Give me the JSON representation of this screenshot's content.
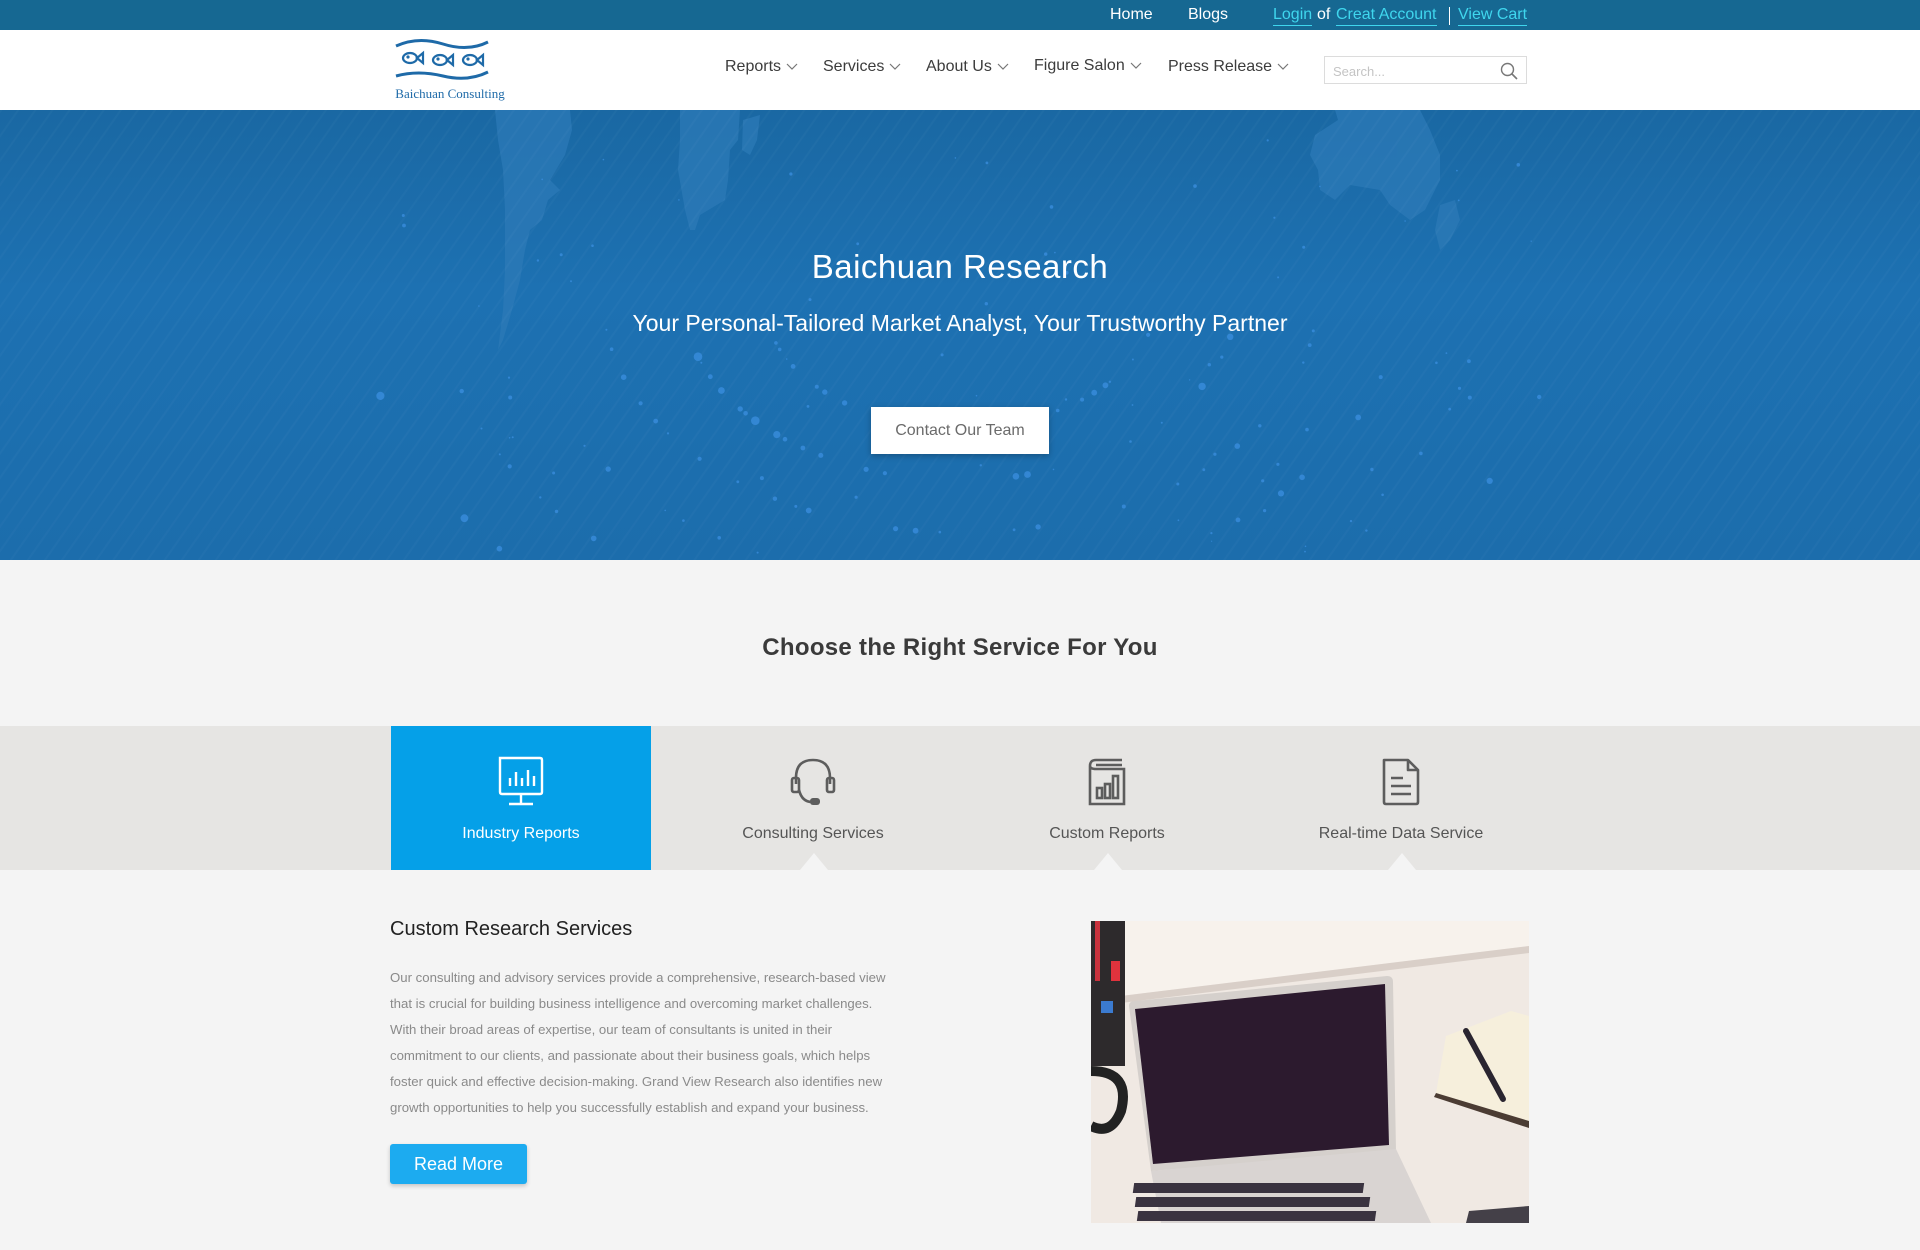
{
  "topbar": {
    "home": "Home",
    "blogs": "Blogs",
    "login": "Login",
    "of": "of",
    "create_account": "Creat Account",
    "view_cart": "View Cart"
  },
  "header": {
    "logo_text": "Baichuan Consulting",
    "nav": [
      {
        "label": "Reports"
      },
      {
        "label": "Services"
      },
      {
        "label": "About Us"
      },
      {
        "label": "Figure Salon"
      },
      {
        "label": "Press Release"
      }
    ],
    "search_placeholder": "Search...",
    "search_value": ""
  },
  "hero": {
    "title": "Baichuan Research",
    "subtitle": "Your Personal-Tailored Market Analyst, Your Trustworthy Partner",
    "cta": "Contact Our Team"
  },
  "services": {
    "heading": "Choose the Right Service For You",
    "tabs": [
      {
        "label": "Industry Reports",
        "icon": "monitor-chart-icon",
        "active": true
      },
      {
        "label": "Consulting Services",
        "icon": "headset-icon",
        "active": false
      },
      {
        "label": "Custom Reports",
        "icon": "report-book-icon",
        "active": false
      },
      {
        "label": "Real-time Data Service",
        "icon": "document-icon",
        "active": false
      }
    ]
  },
  "content": {
    "title": "Custom Research Services",
    "paragraph_lines": [
      "Our consulting and advisory services provide a comprehensive, research-based view",
      "that is crucial for building business intelligence and overcoming market challenges.",
      "With their broad areas of expertise, our team of consultants is united in their",
      "commitment to our clients, and passionate about their business goals, which helps",
      "foster quick and effective decision-making. Grand View Research also identifies new",
      "growth opportunities to help you successfully establish and expand your business."
    ],
    "read_more": "Read More",
    "image_alt": "Laptop on desk with notebook and pen"
  },
  "colors": {
    "topbar_bg": "#166892",
    "link_cyan": "#3fd6ee",
    "hero_blue": "#1c6dac",
    "active_tab": "#05a0e8",
    "button_blue": "#1cabf0",
    "tab_band": "#e6e5e3",
    "page_bg": "#f4f4f4"
  }
}
